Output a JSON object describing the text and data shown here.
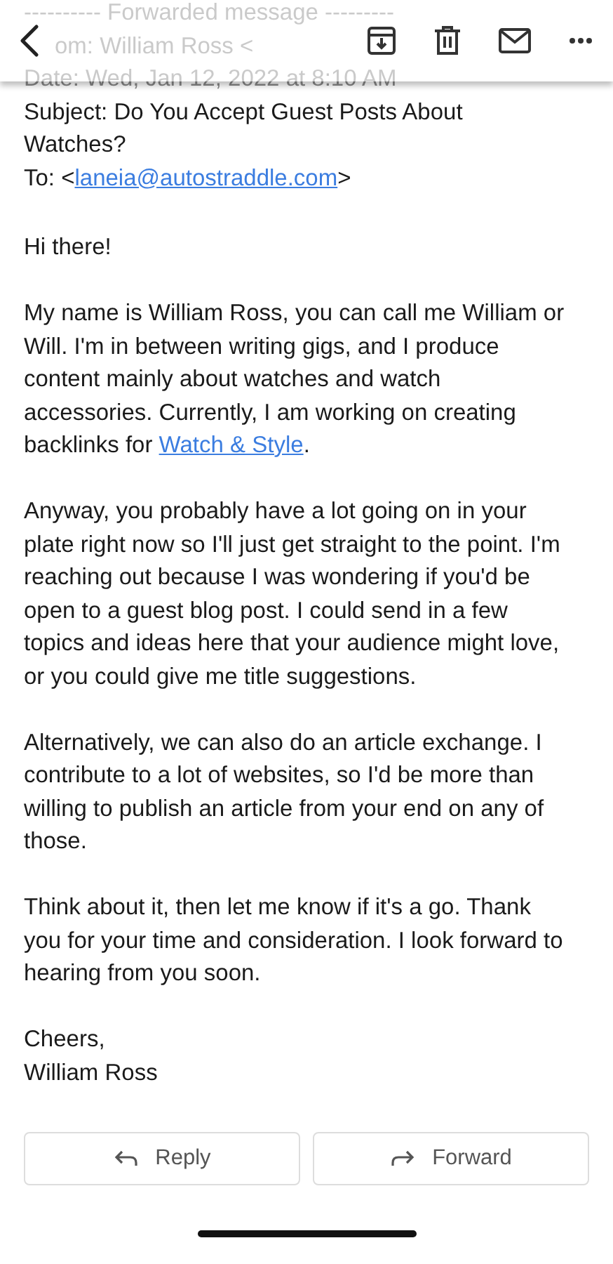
{
  "forwarded_header": {
    "divider_line": "---------- Forwarded message ---------",
    "from": "om: William Ross <",
    "date": "Date: Wed, Jan 12, 2022 at 8:10 AM"
  },
  "subject": "Subject: Do You Accept Guest Posts About Watches?",
  "to": {
    "prefix": "To: <",
    "email": "laneia@autostraddle.com",
    "suffix": ">"
  },
  "paragraphs": [
    {
      "text": "Hi there!"
    },
    {
      "text": "My name is William Ross, you can call me William or Will. I'm in between writing gigs, and I produce content mainly about watches and watch accessories. Currently, I am working on creating backlinks for ",
      "link": "Watch & Style",
      "after": "."
    },
    {
      "text": "Anyway, you probably have a lot going on in your plate right now so I'll just get straight to the point. I'm reaching out because I was wondering if you'd be open to a guest blog post. I could send in a few topics and ideas here that your audience might love, or you could give me title suggestions."
    },
    {
      "text": "Alternatively, we can also do an article exchange. I contribute to a lot of websites, so I'd be more than willing to publish an article from your end on any of those."
    },
    {
      "text": "Think about it, then let me know if it's a go. Thank you for your time and consideration. I look forward to hearing from you soon."
    }
  ],
  "signoff": [
    "Cheers,",
    "William Ross"
  ],
  "buttons": [
    {
      "label": "Reply",
      "kind": "reply"
    },
    {
      "label": "Forward",
      "kind": "forward"
    }
  ]
}
